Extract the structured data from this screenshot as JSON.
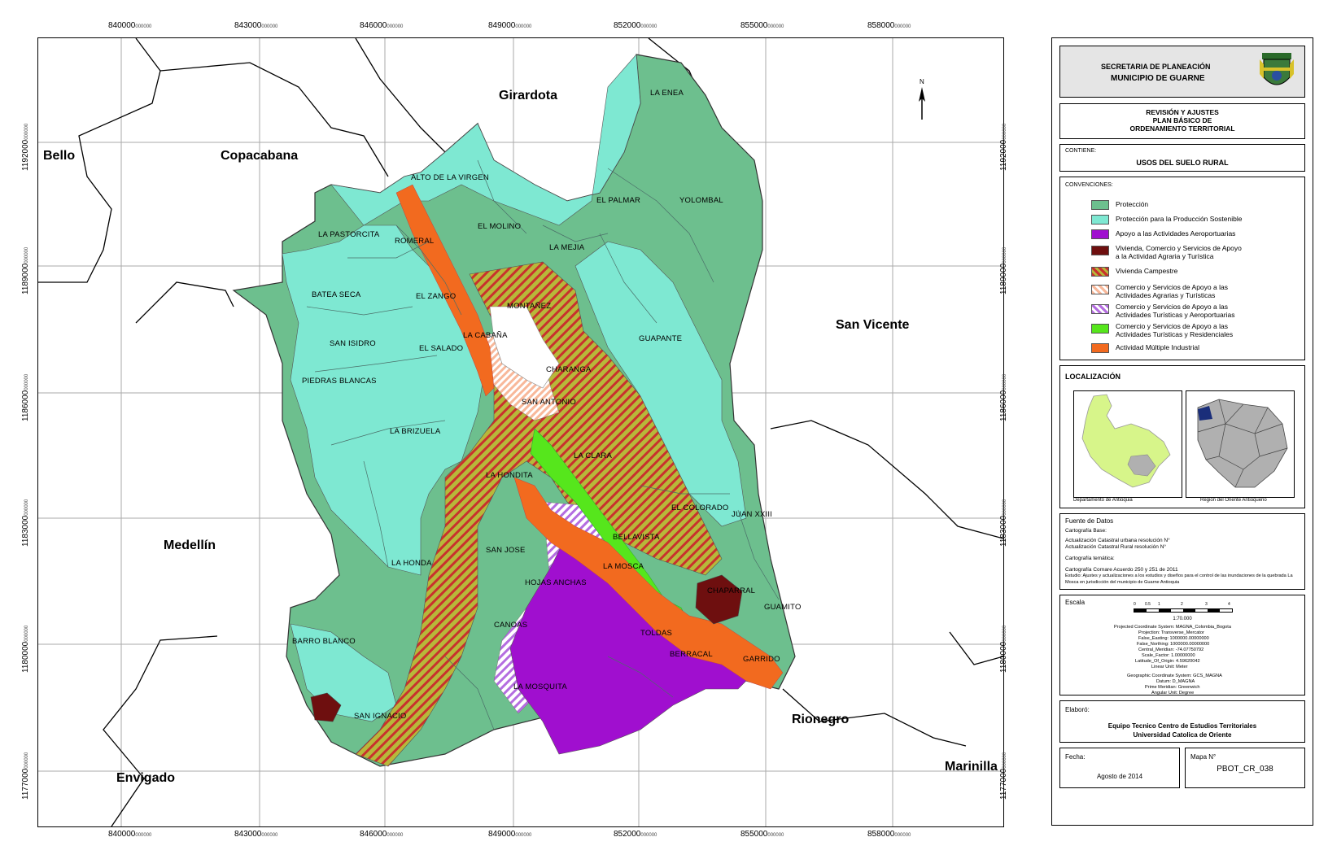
{
  "colors": {
    "proteccion": "#6dbf8e",
    "proteccion_produccion": "#7ee8d2",
    "apoyo_aeroportuarias": "#a00fcf",
    "vivienda_comercio": "#6e0f0f",
    "vivienda_campestre": "#b7b83a",
    "comercio_agrarias": "#f8b89a",
    "comercio_aeroportuarias": "#b46de0",
    "comercio_residenciales": "#56e61c",
    "industrial": "#f26a1f"
  },
  "map": {
    "top_ticks": [
      {
        "main": "840000",
        "dec": "000000"
      },
      {
        "main": "843000",
        "dec": "000000"
      },
      {
        "main": "846000",
        "dec": "000000"
      },
      {
        "main": "849000",
        "dec": "000000"
      },
      {
        "main": "852000",
        "dec": "000000"
      },
      {
        "main": "855000",
        "dec": "000000"
      },
      {
        "main": "858000",
        "dec": "000000"
      }
    ],
    "left_ticks": [
      {
        "main": "1192000",
        "dec": "000000"
      },
      {
        "main": "1189000",
        "dec": "000000"
      },
      {
        "main": "1186000",
        "dec": "000000"
      },
      {
        "main": "1183000",
        "dec": "000000"
      },
      {
        "main": "1180000",
        "dec": "000000"
      },
      {
        "main": "1177000",
        "dec": "000000"
      }
    ],
    "municipios": [
      "Bello",
      "Copacabana",
      "Girardota",
      "San Vicente",
      "Medellín",
      "Rionegro",
      "Envigado",
      "Marinilla"
    ],
    "veredas": [
      "ALTO DE LA VIRGEN",
      "LA ENEA",
      "EL PALMAR",
      "YOLOMBAL",
      "EL MOLINO",
      "LA PASTORCITA",
      "ROMERAL",
      "LA MEJIA",
      "BATEA SECA",
      "EL ZANGO",
      "MONTAÑEZ",
      "LA CABAÑA",
      "SAN ISIDRO",
      "EL SALADO",
      "GUAPANTE",
      "CHARANGA",
      "PIEDRAS BLANCAS",
      "SAN ANTONIO",
      "LA BRIZUELA",
      "LA CLARA",
      "LA HONDITA",
      "EL COLORADO",
      "JUAN XXIII",
      "BELLAVISTA",
      "SAN JOSE",
      "LA HONDA",
      "LA MOSCA",
      "HOJAS ANCHAS",
      "CHAPARRAL",
      "GUAMITO",
      "CANOAS",
      "TOLDAS",
      "BARRO BLANCO",
      "BERRACAL",
      "GARRIDO",
      "LA MOSQUITA",
      "SAN IGNACIO"
    ]
  },
  "panel": {
    "org_line1": "SECRETARIA DE PLANEACIÓN",
    "org_line2": "MUNICIPIO DE GUARNE",
    "project_line1": "REVISIÓN Y AJUSTES",
    "project_line2": "PLAN BÁSICO DE",
    "project_line3": "ORDENAMIENTO TERRITORIAL",
    "contiene_label": "CONTIENE:",
    "contiene_value": "USOS DEL SUELO RURAL",
    "convenciones_label": "CONVENCIONES:",
    "legend": [
      {
        "label": "Protección",
        "key": "proteccion"
      },
      {
        "label": "Protección para la Producción Sostenible",
        "key": "proteccion_produccion"
      },
      {
        "label": "Apoyo a las Actividades Aeroportuarias",
        "key": "apoyo_aeroportuarias"
      },
      {
        "label": "Vivienda, Comercio y Servicios de Apoyo a la Actividad Agraria y Turística",
        "key": "vivienda_comercio"
      },
      {
        "label": "Vivienda Campestre",
        "key": "vivienda_campestre"
      },
      {
        "label": "Comercio y Servicios de Apoyo a las Actividades Agrarias y Turísticas",
        "key": "comercio_agrarias"
      },
      {
        "label": "Comercio y Servicios de Apoyo a las Actividades Turísticas y Aeroportuarias",
        "key": "comercio_aeroportuarias"
      },
      {
        "label": "Comercio y Servicios de Apoyo a las Actividades Turísticas y Residenciales",
        "key": "comercio_residenciales"
      },
      {
        "label": "Actividad Múltiple Industrial",
        "key": "industrial"
      }
    ],
    "localizacion_label": "LOCALIZACIÓN",
    "loc_caption_1": "Departamento de Antioquia",
    "loc_caption_2": "Region del Oriente Antioqueño",
    "fuente_label": "Fuente de Datos",
    "fuente_lines": [
      "Cartografía Base:",
      "Actualización Catastral urbana resolución N°",
      "Actualización Catastral Rural resolución N°",
      "Cartografía temática:",
      "Cartografía Cornare Acuerdo 250 y 251 de 2011",
      "Estudio: Ajustes y actualizaciones a los estudios y diseños para el control de las inundaciones de la quebrada La Mosca en jurisdicción del municipio de Guarne Antioquia"
    ],
    "escala_label": "Escala",
    "scale_ticks": [
      "0",
      "0.5",
      "1",
      "2",
      "3",
      "4"
    ],
    "scale_text": "1:70.000",
    "projection_lines": [
      "Projected Coordinate System: MAGNA_Colombia_Bogota",
      "Projection: Transverse_Mercator",
      "False_Easting: 1000000.00000000",
      "False_Northing: 1000000.00000000",
      "Central_Meridian: -74.07750792",
      "Scale_Factor: 1.00000000",
      "Latitude_Of_Origin: 4.59620042",
      "Linear Unit: Meter",
      "Geographic Coordinate System: GCS_MAGNA",
      "Datum: D_MAGNA",
      "Prime Meridian: Greenwich",
      "Angular Unit: Degree"
    ],
    "elaboro_label": "Elaboró:",
    "elaboro_line1": "Equipo Tecnico Centro de Estudios Territoriales",
    "elaboro_line2": "Universidad Catolica de Oriente",
    "fecha_label": "Fecha:",
    "fecha_value": "Agosto de 2014",
    "mapa_label": "Mapa N°",
    "mapa_value": "PBOT_CR_038"
  }
}
